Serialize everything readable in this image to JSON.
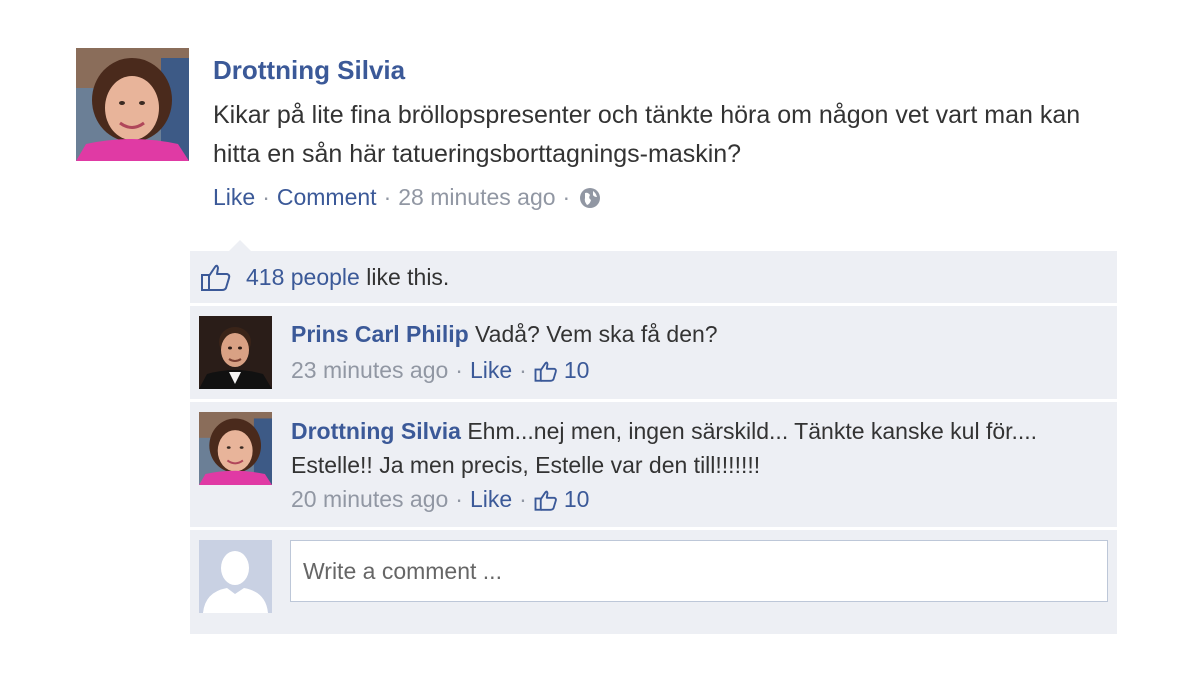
{
  "post": {
    "author": "Drottning Silvia",
    "text": "Kikar på lite fina bröllopspresenter och tänkte höra om någon vet vart man kan hitta en sån här tatueringsborttagnings-maskin?",
    "actions": {
      "like": "Like",
      "comment": "Comment",
      "timestamp": "28 minutes ago",
      "separator": "·",
      "privacy_icon": "globe-icon"
    }
  },
  "likes_summary": {
    "people": "418 people",
    "suffix": " like this.",
    "icon": "thumbs-up-icon"
  },
  "comments": [
    {
      "author": "Prins Carl Philip",
      "text": " Vadå? Vem ska få den?",
      "timestamp": "23 minutes ago",
      "like_label": "Like",
      "like_count": "10"
    },
    {
      "author": "Drottning Silvia",
      "text": " Ehm...nej men, ingen särskild... Tänkte kanske kul för.... Estelle!! Ja men precis, Estelle var den till!!!!!!!",
      "timestamp": "20 minutes ago",
      "like_label": "Like",
      "like_count": "10"
    }
  ],
  "composer": {
    "placeholder": "Write a comment ..."
  },
  "colors": {
    "link": "#3b5998",
    "ufi_background": "#edeff4",
    "meta_text": "#9197a3",
    "body_text": "#333333"
  }
}
